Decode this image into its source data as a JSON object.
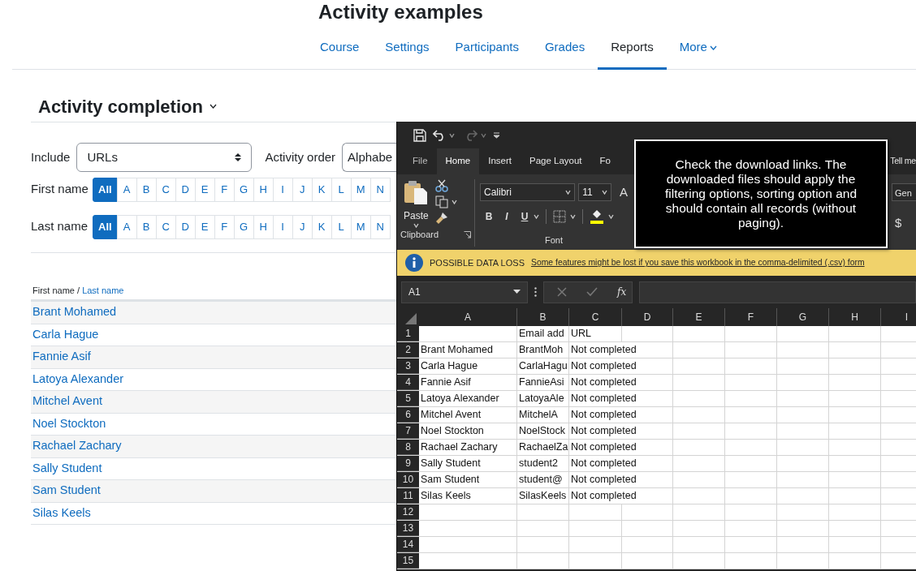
{
  "page": {
    "title": "Activity examples",
    "nav": [
      {
        "label": "Course",
        "selected": false
      },
      {
        "label": "Settings",
        "selected": false
      },
      {
        "label": "Participants",
        "selected": false
      },
      {
        "label": "Grades",
        "selected": false
      },
      {
        "label": "Reports",
        "selected": true
      },
      {
        "label": "More",
        "selected": false,
        "kind": "dropdown"
      }
    ],
    "heading": "Activity completion",
    "filters": {
      "include_label": "Include",
      "include_value": "URLs",
      "order_label": "Activity order",
      "order_value": "Alphabe"
    },
    "initial_bars": [
      {
        "label": "First name",
        "letters": [
          {
            "label": "All",
            "selected": true
          },
          {
            "label": "A",
            "selected": false
          },
          {
            "label": "B",
            "selected": false
          },
          {
            "label": "C",
            "selected": false
          },
          {
            "label": "D",
            "selected": false
          },
          {
            "label": "E",
            "selected": false
          },
          {
            "label": "F",
            "selected": false
          },
          {
            "label": "G",
            "selected": false
          },
          {
            "label": "H",
            "selected": false
          },
          {
            "label": "I",
            "selected": false
          },
          {
            "label": "J",
            "selected": false
          },
          {
            "label": "K",
            "selected": false
          },
          {
            "label": "L",
            "selected": false
          },
          {
            "label": "M",
            "selected": false
          },
          {
            "label": "N",
            "selected": false
          }
        ]
      },
      {
        "label": "Last name",
        "letters": [
          {
            "label": "All",
            "selected": true
          },
          {
            "label": "A",
            "selected": false
          },
          {
            "label": "B",
            "selected": false
          },
          {
            "label": "C",
            "selected": false
          },
          {
            "label": "D",
            "selected": false
          },
          {
            "label": "E",
            "selected": false
          },
          {
            "label": "F",
            "selected": false
          },
          {
            "label": "G",
            "selected": false
          },
          {
            "label": "H",
            "selected": false
          },
          {
            "label": "I",
            "selected": false
          },
          {
            "label": "J",
            "selected": false
          },
          {
            "label": "K",
            "selected": false
          },
          {
            "label": "L",
            "selected": false
          },
          {
            "label": "M",
            "selected": false
          },
          {
            "label": "N",
            "selected": false
          }
        ]
      }
    ],
    "table": {
      "header_first": "First name",
      "header_separator": "/",
      "header_last": "Last name",
      "rows": [
        "Brant Mohamed",
        "Carla Hague",
        "Fannie Asif",
        "Latoya Alexander",
        "Mitchel Avent",
        "Noel Stockton",
        "Rachael Zachary",
        "Sally Student",
        "Sam Student",
        "Silas Keels"
      ]
    }
  },
  "excel": {
    "tabs": [
      {
        "label": "File",
        "selected": false
      },
      {
        "label": "Home",
        "selected": true
      },
      {
        "label": "Insert",
        "selected": false
      },
      {
        "label": "Page Layout",
        "selected": false
      },
      {
        "label": "Fo",
        "selected": false
      },
      {
        "label": "Tell me",
        "selected": false,
        "kind": "search"
      }
    ],
    "ribbon": {
      "paste_label": "Paste",
      "clipboard_label": "Clipboard",
      "font_name": "Calibri",
      "font_size": "11",
      "grow_font": "A",
      "format_buttons": [
        "B",
        "I",
        "U"
      ],
      "font_label": "Font",
      "number_format": "Gen",
      "currency": "$"
    },
    "notice": {
      "title": "POSSIBLE DATA LOSS",
      "message": "Some features might be lost if you save this workbook in the comma-delimited (.csv) form"
    },
    "formula_bar": {
      "name_box": "A1",
      "function_label": "fx"
    },
    "sheet": {
      "columns": [
        "A",
        "B",
        "C",
        "D",
        "E",
        "F",
        "G",
        "H",
        "I"
      ],
      "rows": [
        {
          "number": "1",
          "cells": [
            "",
            "Email add",
            "URL"
          ]
        },
        {
          "number": "2",
          "cells": [
            "Brant Mohamed",
            "BrantMoh",
            "Not completed"
          ]
        },
        {
          "number": "3",
          "cells": [
            "Carla Hague",
            "CarlaHagu",
            "Not completed"
          ]
        },
        {
          "number": "4",
          "cells": [
            "Fannie Asif",
            "FannieAsi",
            "Not completed"
          ]
        },
        {
          "number": "5",
          "cells": [
            "Latoya Alexander",
            "LatoyaAle",
            "Not completed"
          ]
        },
        {
          "number": "6",
          "cells": [
            "Mitchel Avent",
            "MitchelA",
            "Not completed"
          ]
        },
        {
          "number": "7",
          "cells": [
            "Noel Stockton",
            "NoelStock",
            "Not completed"
          ]
        },
        {
          "number": "8",
          "cells": [
            "Rachael Zachary",
            "RachaelZa",
            "Not completed"
          ]
        },
        {
          "number": "9",
          "cells": [
            "Sally Student",
            "student2",
            "Not completed"
          ]
        },
        {
          "number": "10",
          "cells": [
            "Sam Student",
            "student@",
            "Not completed"
          ]
        },
        {
          "number": "11",
          "cells": [
            "Silas Keels",
            "SilasKeels",
            "Not completed"
          ]
        },
        {
          "number": "12",
          "cells": []
        },
        {
          "number": "13",
          "cells": []
        },
        {
          "number": "14",
          "cells": []
        },
        {
          "number": "15",
          "cells": []
        }
      ]
    },
    "tooltip": "Check the download links. The downloaded files should apply the filtering options, sorting option and should contain all records (without paging)."
  }
}
